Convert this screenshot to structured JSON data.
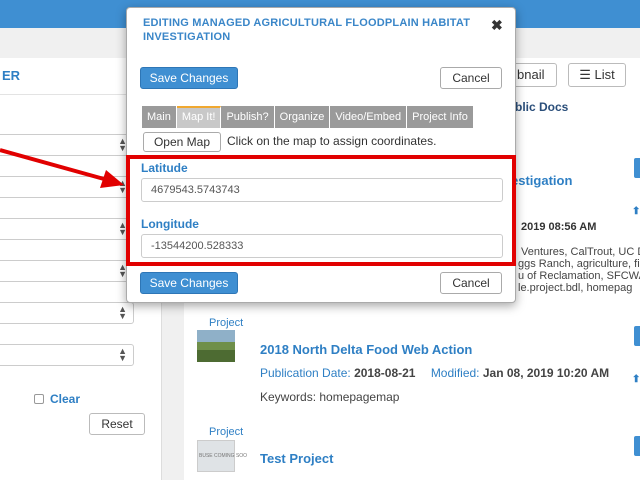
{
  "left_panel": {
    "title": "ER",
    "clear_label": "Clear",
    "reset_label": "Reset"
  },
  "right_panel": {
    "thumbnail_label": "bnail",
    "list_label": "List",
    "public_docs": "blic Docs",
    "result1": {
      "title_fragment": "estigation",
      "modified_date": "2019 08:56 AM",
      "line1": "Ventures, CalTrout, UC D",
      "line2": "ggs Ranch, agriculture, fis",
      "line3": "u of Reclamation, SFCWA",
      "line4": "le.project.bdl, homepag"
    },
    "result2": {
      "type": "Project",
      "title": "2018 North Delta Food Web Action",
      "pub_label": "Publication Date:",
      "pub_date": "2018-08-21",
      "mod_label": "Modified:",
      "mod_date": "Jan 08, 2019 10:20 AM",
      "keywords": "Keywords: homepagemap"
    },
    "result3": {
      "type": "Project",
      "title": "Test Project",
      "thumb_text": "BUSE COMING SOO"
    }
  },
  "modal": {
    "title": "EDITING MANAGED AGRICULTURAL FLOODPLAIN HABITAT INVESTIGATION",
    "close_symbol": "✖",
    "save_label": "Save Changes",
    "cancel_label": "Cancel",
    "tabs": [
      "Main",
      "Map It!",
      "Publish?",
      "Organize",
      "Video/Embed",
      "Project Info"
    ],
    "open_map_label": "Open Map",
    "map_hint": "Click on the map to assign coordinates.",
    "latitude_label": "Latitude",
    "latitude_value": "4679543.5743743",
    "longitude_label": "Longitude",
    "longitude_value": "-13544200.528333"
  },
  "colors": {
    "accent": "#3f8fd2",
    "annotation": "#e10000",
    "active_tab_marker": "#f0a830"
  }
}
